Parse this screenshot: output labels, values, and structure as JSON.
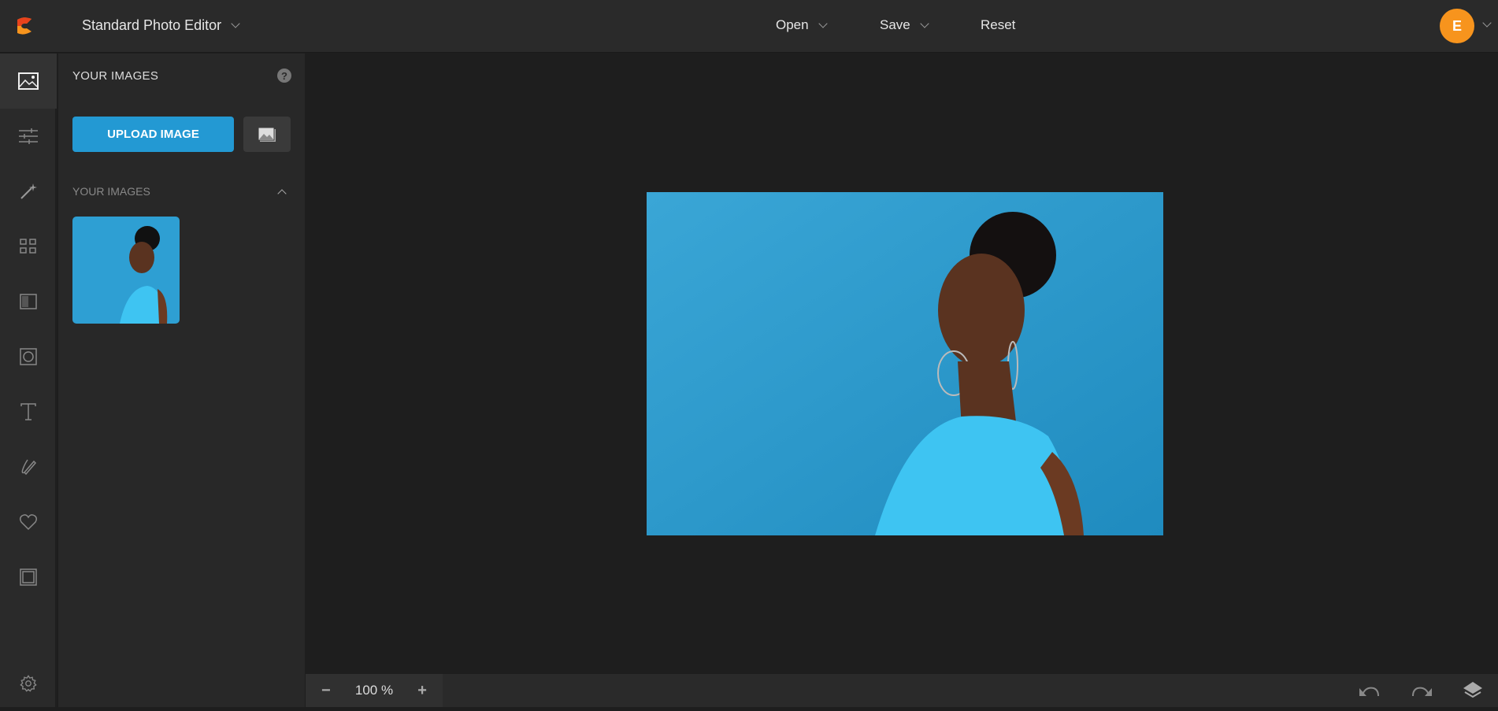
{
  "header": {
    "app_name": "Standard Photo Editor",
    "menu": {
      "open": "Open",
      "save": "Save",
      "reset": "Reset"
    },
    "avatar_initial": "E",
    "brand_color": "#f7941d"
  },
  "rail": {
    "items": [
      "images-icon",
      "adjust-sliders-icon",
      "magic-wand-icon",
      "grid-icon",
      "texture-icon",
      "vignette-icon",
      "text-icon",
      "draw-icon",
      "heart-icon",
      "frame-icon"
    ],
    "settings": "gear-icon",
    "active": "images-icon"
  },
  "panel": {
    "title": "YOUR IMAGES",
    "help": "?",
    "upload_label": "UPLOAD IMAGE",
    "section_title": "YOUR IMAGES",
    "accent": "#2399d3"
  },
  "bottom": {
    "zoom_out": "−",
    "zoom_level": "100 %",
    "zoom_in": "+"
  }
}
